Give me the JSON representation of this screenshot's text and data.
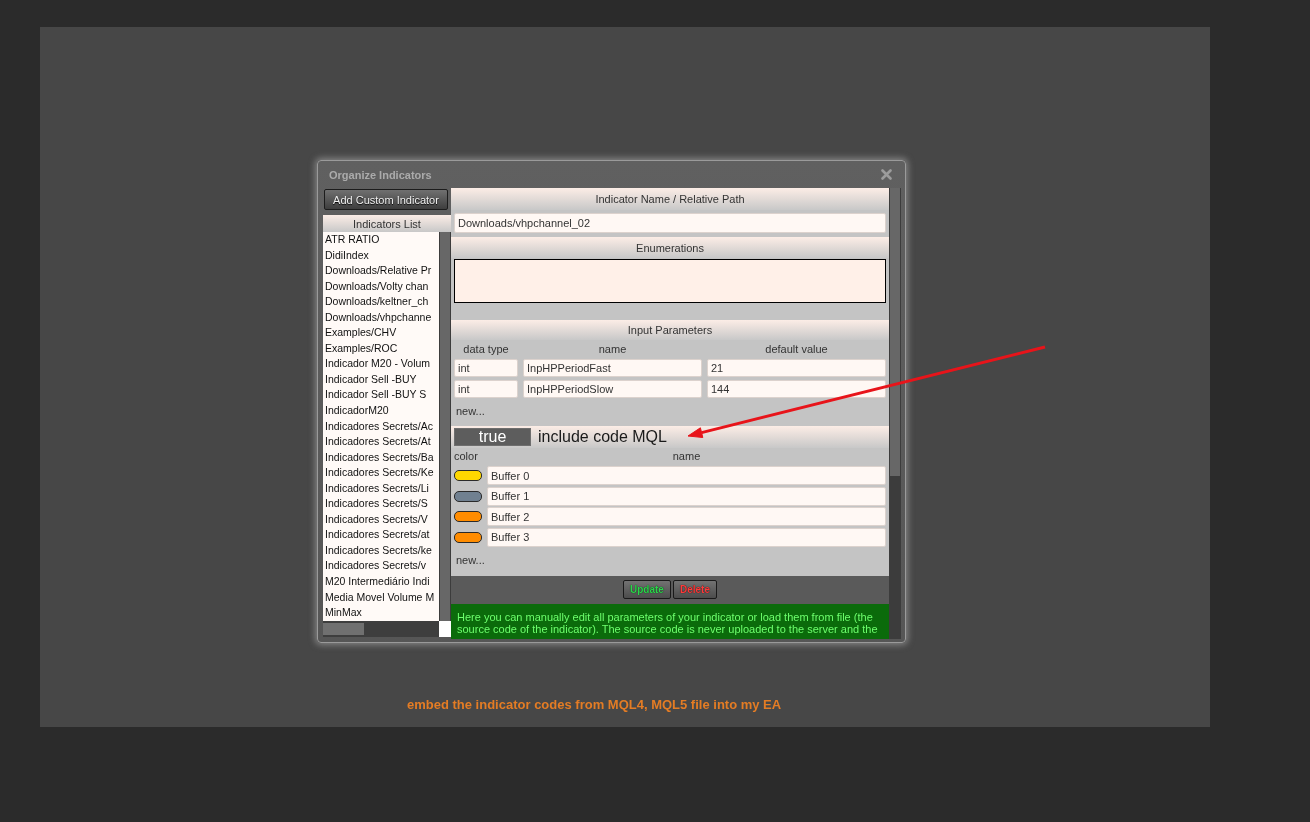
{
  "window": {
    "title": "Organize Indicators"
  },
  "sidebar": {
    "add_button": "Add Custom Indicator",
    "list_title": "Indicators List",
    "items": [
      {
        "label": "ATR RATIO",
        "selected": false
      },
      {
        "label": "DidiIndex",
        "selected": false
      },
      {
        "label": "Downloads/Relative Pr",
        "selected": false
      },
      {
        "label": "Downloads/Volty chan",
        "selected": false
      },
      {
        "label": "Downloads/keltner_ch",
        "selected": false
      },
      {
        "label": "Downloads/vhpchanne",
        "selected": false
      },
      {
        "label": "Examples/CHV",
        "selected": false
      },
      {
        "label": "Examples/ROC",
        "selected": false
      },
      {
        "label": "Indicador M20 - Volum",
        "selected": false
      },
      {
        "label": "Indicador Sell -BUY",
        "selected": false
      },
      {
        "label": "Indicador Sell -BUY S",
        "selected": false
      },
      {
        "label": "IndicadorM20",
        "selected": false
      },
      {
        "label": "Indicadores Secrets/Ac",
        "selected": false
      },
      {
        "label": "Indicadores Secrets/At",
        "selected": false
      },
      {
        "label": "Indicadores Secrets/Ba",
        "selected": false
      },
      {
        "label": "Indicadores Secrets/Ke",
        "selected": false
      },
      {
        "label": "Indicadores Secrets/Li",
        "selected": false
      },
      {
        "label": "Indicadores Secrets/S",
        "selected": false
      },
      {
        "label": "Indicadores Secrets/V",
        "selected": false
      },
      {
        "label": "Indicadores Secrets/at",
        "selected": false
      },
      {
        "label": "Indicadores Secrets/ke",
        "selected": false
      },
      {
        "label": "Indicadores Secrets/v",
        "selected": false
      },
      {
        "label": "M20 Intermediário Indi",
        "selected": false
      },
      {
        "label": "Media Movel Volume M",
        "selected": false
      },
      {
        "label": "MinMax",
        "selected": false
      }
    ]
  },
  "indicator_name": {
    "title": "Indicator Name / Relative Path",
    "value": "Downloads/vhpchannel_02"
  },
  "enumerations": {
    "title": "Enumerations"
  },
  "input_parameters": {
    "title": "Input Parameters",
    "columns": [
      "data type",
      "name",
      "default value"
    ],
    "rows": [
      {
        "data_type": "int",
        "name": "InpHPPeriodFast",
        "default_value": "21"
      },
      {
        "data_type": "int",
        "name": "InpHPPeriodSlow",
        "default_value": "144"
      }
    ],
    "new_link": "new..."
  },
  "include_code": {
    "value": "true",
    "label": "include code MQL"
  },
  "buffers": {
    "columns": [
      "color",
      "name"
    ],
    "rows": [
      {
        "color": "#ffd700",
        "name": "Buffer 0"
      },
      {
        "color": "#708090",
        "name": "Buffer 1"
      },
      {
        "color": "#ff8c00",
        "name": "Buffer 2"
      },
      {
        "color": "#ff8c00",
        "name": "Buffer 3"
      }
    ],
    "new_link": "new..."
  },
  "actions": [
    {
      "label": "Update",
      "kind": "update"
    },
    {
      "label": "Delete",
      "kind": "delete"
    }
  ],
  "help_text": "Here you can manually edit all parameters of your indicator or load them from file (the source code of the indicator). The source code is never uploaded to the server and the",
  "caption": "embed the indicator codes from MQL4, MQL5 file into my EA"
}
